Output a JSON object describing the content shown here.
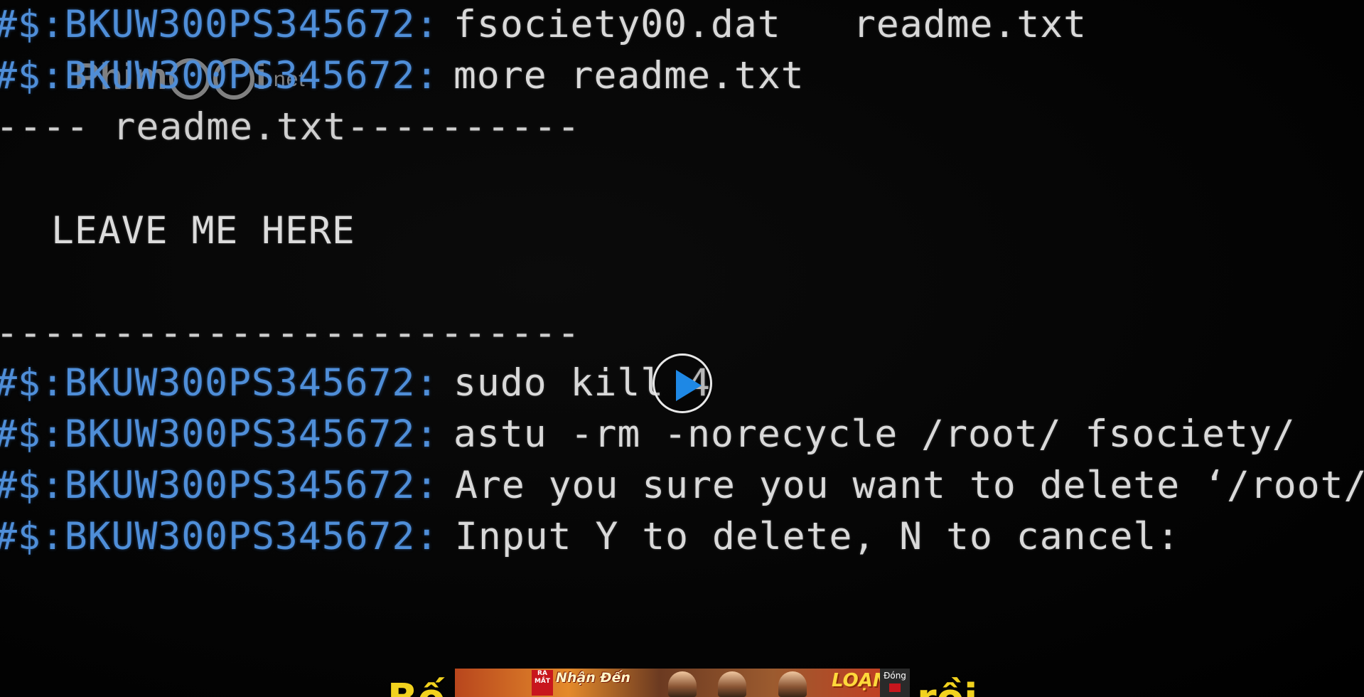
{
  "watermark": {
    "brand_left": "Phim",
    "brand_right": "i",
    "tld": ".net"
  },
  "terminal": {
    "prompt": "#$:BKUW300PS345672:",
    "lines": {
      "ls": {
        "file1": "fsociety00.dat",
        "file2": "readme.txt"
      },
      "more": {
        "command": "more  readme.txt"
      },
      "header_divider": "---- readme.txt----------",
      "message": "LEAVE ME HERE",
      "footer_divider": "-------------------------",
      "kill": {
        "command": "sudo kill 4"
      },
      "rm": {
        "command": "astu -rm -norecycle /root/ fsociety/"
      },
      "confirm": {
        "text": "Are you sure you want to delete ‘/root/ fso"
      },
      "input": {
        "text": "Input Y to delete, N to cancel:"
      }
    }
  },
  "player": {
    "play_icon": "play-icon",
    "accent_color": "#1e88e5"
  },
  "ad": {
    "badge": "RA MẮT",
    "title": "Nhận Đến",
    "logo": "LOẠN",
    "close_label": "Đóng"
  },
  "subtitle": {
    "left_fragment": "Bố",
    "right_fragment": "rồi"
  },
  "colors": {
    "prompt": "#4f8ed8",
    "command": "#d9d9d9",
    "subtitle": "#f2d21e"
  }
}
